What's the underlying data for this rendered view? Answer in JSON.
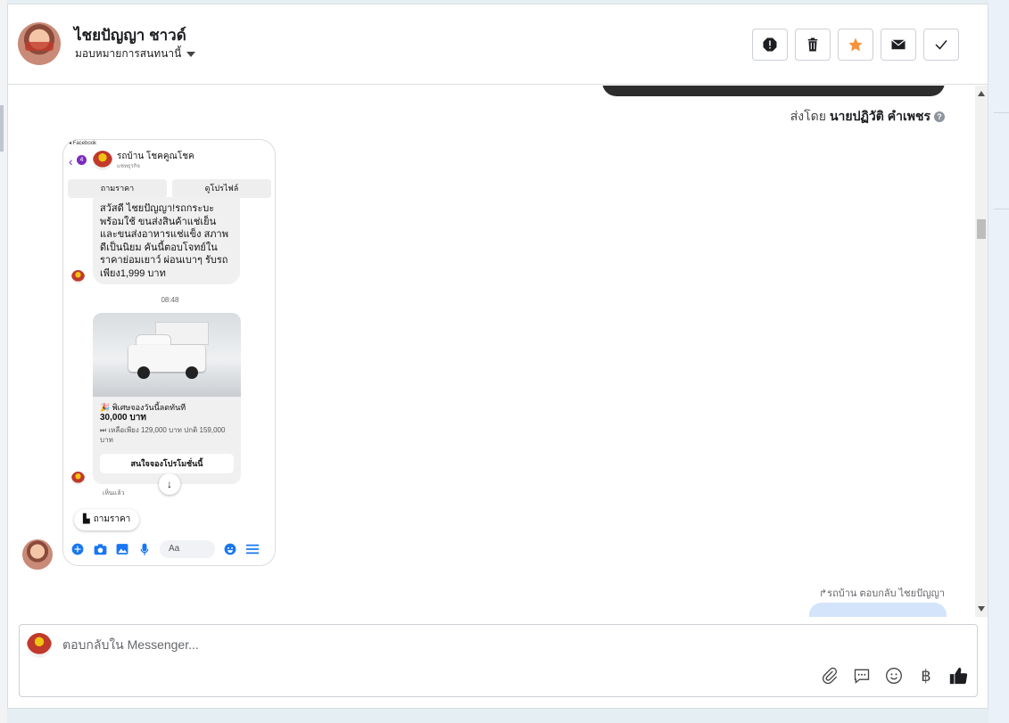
{
  "header": {
    "name": "ไชยปัญญา ชาวด์",
    "assign_label": "มอบหมายการสนทนานี้",
    "actions": [
      "spam",
      "delete",
      "star",
      "mark-unread",
      "done"
    ],
    "star_color": "#f7923a"
  },
  "thread": {
    "sent_by_prefix": "ส่งโดย",
    "sent_by_name": "นายปฏิวัติ คำเพชร",
    "reply_note": "รถบ้าน ตอบกลับ ไชยปัญญา"
  },
  "screenshot": {
    "fb_label": "◂ Facebook",
    "back_count": "4",
    "shop_name": "รถบ้าน โชคคูณโชค",
    "shop_sub": "แชทธุรกิจ",
    "btn_ask_price": "ถามราคา",
    "btn_view_profile": "ดูโปรไฟล์",
    "message": "สวัสดี ไชยปัญญา!รถกระบะ พร้อมใช้ ขนส่งสินค้าแช่เย็น และขนส่งอาหารแช่แข็ง สภาพดีเป็นนิยม คันนี้ตอบโจทย์ใน ราคาย่อมเยาว์ ผ่อนเบาๆ รับรถเพียง1,999 บาท",
    "time": "08:48",
    "card_title": "🎉 พิเศษจองวันนี้ลดทันที",
    "card_price": "30,000 บาท",
    "card_old": "⏭ เหลือเพียง 129,000 บาท ปกติ 159,000 บาท",
    "card_cta": "สนใจจองโปรโมชั่นนี้",
    "seen": "เห็นแล้ว",
    "quick_reply": "ถามราคา",
    "input_placeholder": "Aa"
  },
  "composer": {
    "placeholder": "ตอบกลับใน Messenger...",
    "tools": [
      "attach-icon",
      "saved-reply-icon",
      "emoji-icon",
      "baht-icon",
      "like-icon"
    ],
    "baht_glyph": "฿"
  }
}
